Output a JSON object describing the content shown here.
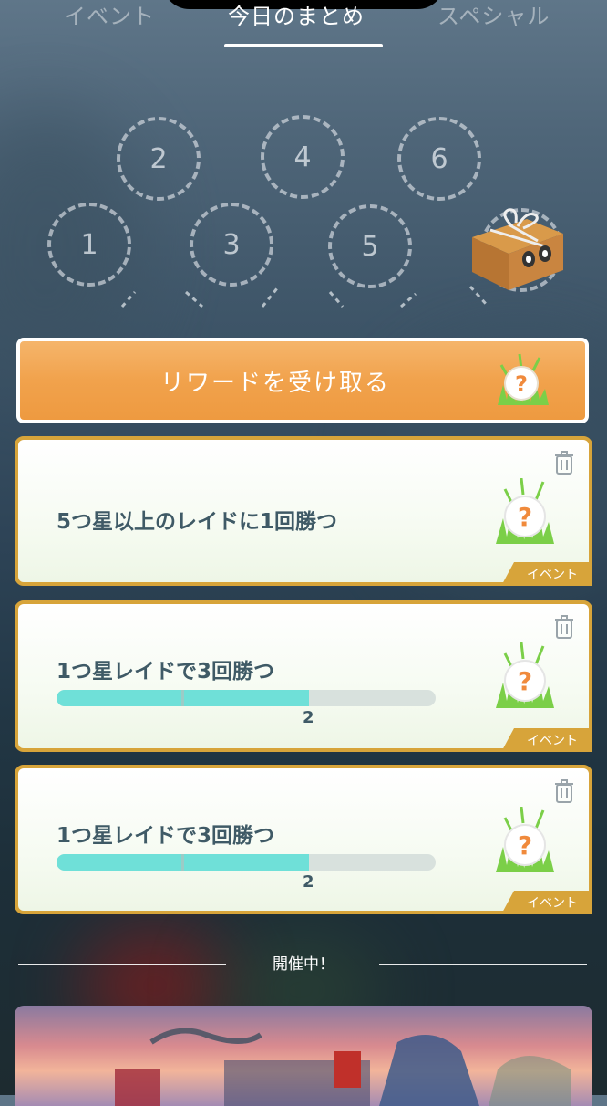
{
  "tabs": [
    "イベント",
    "今日のまとめ",
    "スペシャル"
  ],
  "active_tab_index": 1,
  "streak": {
    "days": [
      "1",
      "2",
      "3",
      "4",
      "5",
      "6"
    ]
  },
  "reward_button": {
    "label": "リワードを受け取る"
  },
  "tasks": [
    {
      "title": "5つ星以上のレイドに1回勝つ",
      "tag": "イベント"
    },
    {
      "title": "1つ星レイドで3回勝つ",
      "tag": "イベント",
      "progress_value": "2",
      "progress_total": 3
    },
    {
      "title": "1つ星レイドで3回勝つ",
      "tag": "イベント",
      "progress_value": "2",
      "progress_total": 3
    }
  ],
  "ongoing": {
    "label": "開催中！"
  },
  "colors": {
    "accent_orange": "#f1a24c",
    "card_border": "#d7a43a",
    "progress_fill": "#6fe0d8",
    "text": "#3f5a66"
  }
}
